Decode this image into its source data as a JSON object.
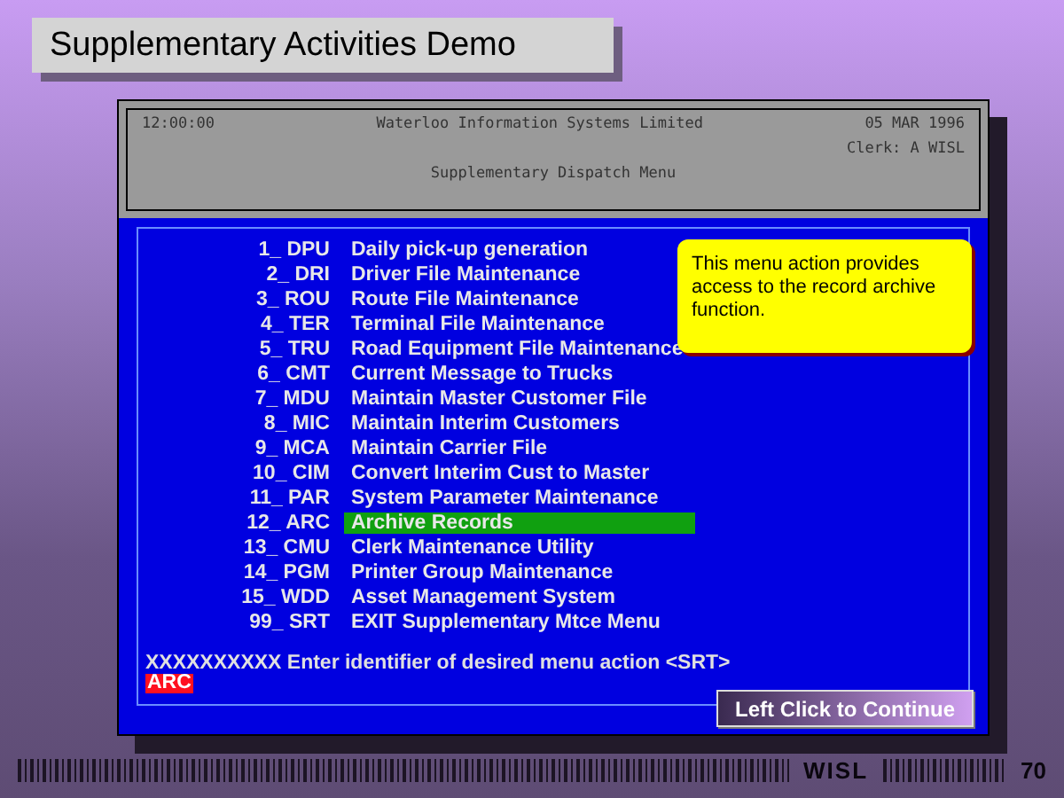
{
  "slide_title": "Supplementary Activities Demo",
  "header": {
    "time": "12:00:00",
    "company": "Waterloo Information Systems Limited",
    "date": "05 MAR 1996",
    "clerk": "Clerk:  A WISL",
    "menu_title": "Supplementary Dispatch Menu"
  },
  "menu_items": [
    {
      "code": "1_ DPU",
      "label": "Daily pick-up generation",
      "selected": false
    },
    {
      "code": "2_ DRI",
      "label": "Driver File Maintenance",
      "selected": false
    },
    {
      "code": "3_ ROU",
      "label": "Route File Maintenance",
      "selected": false
    },
    {
      "code": "4_ TER",
      "label": "Terminal File Maintenance",
      "selected": false
    },
    {
      "code": "5_ TRU",
      "label": "Road Equipment File Maintenance",
      "selected": false
    },
    {
      "code": "6_ CMT",
      "label": "Current Message to Trucks",
      "selected": false
    },
    {
      "code": "7_ MDU",
      "label": "Maintain Master Customer File",
      "selected": false
    },
    {
      "code": "8_ MIC",
      "label": "Maintain Interim Customers",
      "selected": false
    },
    {
      "code": "9_ MCA",
      "label": "Maintain Carrier File",
      "selected": false
    },
    {
      "code": "10_ CIM",
      "label": "Convert Interim Cust to Master",
      "selected": false
    },
    {
      "code": "11_ PAR",
      "label": "System Parameter Maintenance",
      "selected": false
    },
    {
      "code": "12_ ARC",
      "label": "Archive Records",
      "selected": true
    },
    {
      "code": "13_ CMU",
      "label": "Clerk Maintenance Utility",
      "selected": false
    },
    {
      "code": "14_ PGM",
      "label": "Printer Group Maintenance",
      "selected": false
    },
    {
      "code": "15_ WDD",
      "label": "Asset Management System",
      "selected": false
    },
    {
      "code": "99_ SRT",
      "label": "EXIT Supplementary Mtce Menu",
      "selected": false
    }
  ],
  "tooltip": "This menu action provides access to the record archive function.",
  "prompt": "XXXXXXXXXX Enter identifier of desired menu action <SRT>",
  "input_value": "ARC",
  "continue_button": "Left Click to Continue",
  "footer": {
    "brand": "WISL",
    "page_number": "70"
  }
}
